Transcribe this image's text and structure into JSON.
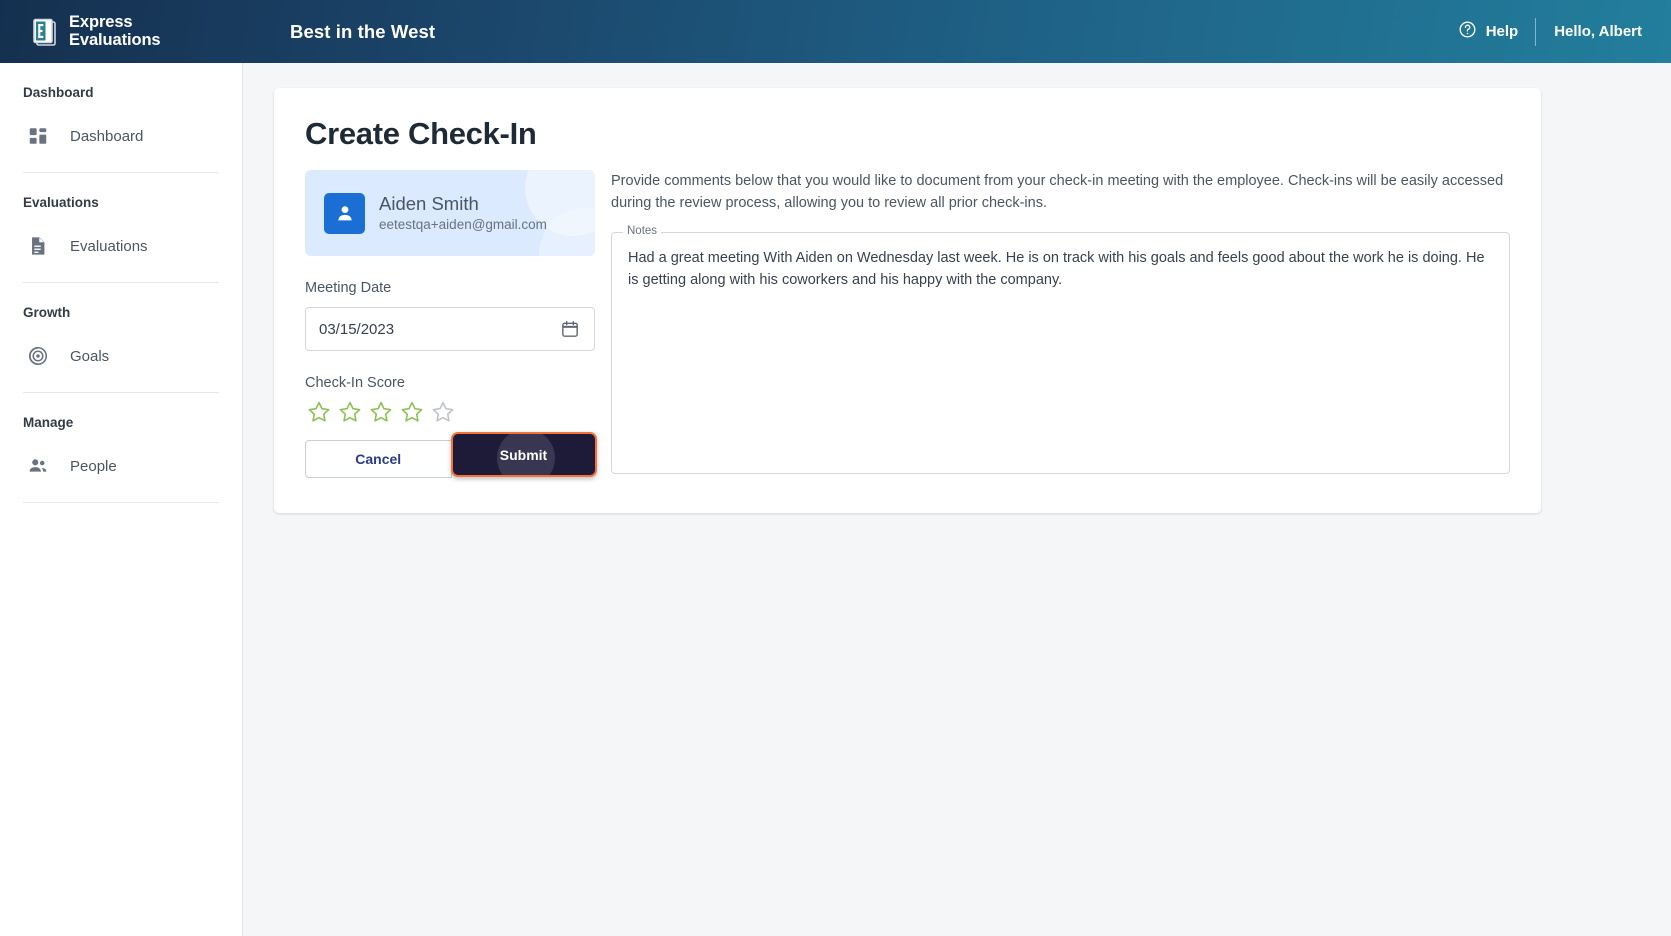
{
  "header": {
    "brand_name": "Express\nEvaluations",
    "brand_logo_icon": "stacked-documents-e-logo",
    "org_title": "Best in the West",
    "help_icon": "question-circle-icon",
    "help_label": "Help",
    "user_greeting": "Hello, Albert",
    "gradient_start": "#15304f",
    "gradient_end": "#227e9c"
  },
  "sidebar": {
    "sections": [
      {
        "title": "Dashboard",
        "items": [
          {
            "label": "Dashboard",
            "icon": "dashboard-grid-icon"
          }
        ]
      },
      {
        "title": "Evaluations",
        "items": [
          {
            "label": "Evaluations",
            "icon": "document-lines-icon"
          }
        ]
      },
      {
        "title": "Growth",
        "items": [
          {
            "label": "Goals",
            "icon": "target-spiral-icon"
          }
        ]
      },
      {
        "title": "Manage",
        "items": [
          {
            "label": "People",
            "icon": "people-group-icon"
          }
        ]
      }
    ]
  },
  "main": {
    "page_title": "Create Check-In",
    "person": {
      "avatar_icon": "person-avatar-icon",
      "name": "Aiden Smith",
      "email": "eetestqa+aiden@gmail.com",
      "avatar_color": "#1b6fd4",
      "card_bg": "#dbeafe"
    },
    "meeting_date": {
      "label": "Meeting Date",
      "value": "03/15/2023",
      "placeholder": "MM/DD/YYYY",
      "calendar_icon": "calendar-icon"
    },
    "check_in_score": {
      "label": "Check-In Score",
      "value": 4,
      "max": 5,
      "filled_color": "#8cc152",
      "empty_color": "#bfc3c7"
    },
    "buttons": {
      "cancel_label": "Cancel",
      "submit_label": "Submit",
      "submit_bg": "#1d1b38",
      "submit_focus_ring": "#f4713a"
    },
    "intro_text": "Provide comments below that you would like to document from your check-in meeting with the employee. Check-ins will be easily accessed during the review process, allowing you to review all prior check-ins.",
    "notes": {
      "legend": "Notes",
      "value": "Had a great meeting With Aiden on Wednesday last week. He is on track with his goals and feels good about the work he is doing. He is getting along with his coworkers and his happy with the company.",
      "placeholder": "Notes"
    }
  }
}
